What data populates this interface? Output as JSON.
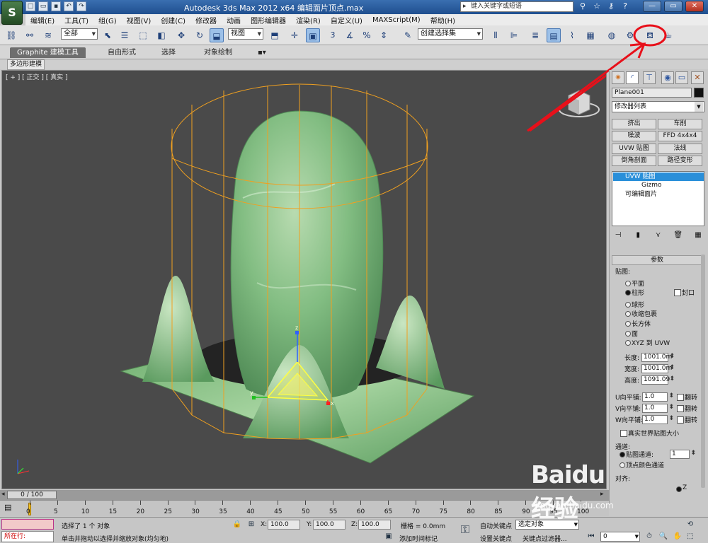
{
  "title": {
    "text": "Autodesk 3ds Max  2012 x64    编辑面片顶点.max",
    "app_logo": "S",
    "search_placeholder": "键入关键字或短语",
    "qa_icons": [
      "new-icon",
      "open-icon",
      "save-icon",
      "undo-icon",
      "redo-icon"
    ],
    "right_icons": [
      "binoculars",
      "star",
      "key",
      "help"
    ]
  },
  "menu": [
    "编辑(E)",
    "工具(T)",
    "组(G)",
    "视图(V)",
    "创建(C)",
    "修改器",
    "动画",
    "图形编辑器",
    "渲染(R)",
    "自定义(U)",
    "MAXScript(M)",
    "帮助(H)"
  ],
  "toolbar": {
    "selection_filter": "全部",
    "ref_coord": "视图",
    "named_selection": "创建选择集",
    "snap_label": "3"
  },
  "ribbon": {
    "tabs": [
      "Graphite 建模工具",
      "自由形式",
      "选择",
      "对象绘制"
    ],
    "sub": "多边形建模"
  },
  "viewport": {
    "label": "[ + ] [ 正交 ] [ 真实 ]",
    "gizmo_axes": {
      "x": "x",
      "y": "y",
      "z": "z"
    }
  },
  "panel": {
    "object_name": "Plane001",
    "modifier_list": "修改器列表",
    "modifier_buttons": [
      "挤出",
      "车削",
      "噪波",
      "FFD 4x4x4",
      "UVW 贴图",
      "法线",
      "倒角剖面",
      "路径变形"
    ],
    "stack": [
      "UVW 贴图",
      "Gizmo",
      "可编辑面片"
    ],
    "rollout_title": "参数",
    "mapping_group": "贴图:",
    "mapping_options": [
      "平面",
      "柱形",
      "球形",
      "收缩包裹",
      "长方体",
      "面",
      "XYZ 到 UVW"
    ],
    "cap_label": "封口",
    "length_label": "长度:",
    "length_value": "1001.0m",
    "width_label": "宽度:",
    "width_value": "1001.0m",
    "height_label": "高度:",
    "height_value": "1091.09",
    "u_tile_label": "U向平铺:",
    "u_tile": "1.0",
    "v_tile_label": "V向平铺:",
    "v_tile": "1.0",
    "w_tile_label": "W向平铺:",
    "w_tile": "1.0",
    "flip_label": "翻转",
    "real_world_label": "真实世界贴图大小",
    "channel_group": "通道:",
    "map_channel_label": "贴图通道:",
    "map_channel_value": "1",
    "vertex_color_label": "顶点颜色通道",
    "align_group": "对齐:",
    "align_z": "Z"
  },
  "timeline": {
    "frame_display": "0 / 100",
    "ticks": [
      "0",
      "5",
      "10",
      "15",
      "20",
      "25",
      "30",
      "35",
      "40",
      "45",
      "50",
      "55",
      "60",
      "65",
      "70",
      "75",
      "80",
      "85",
      "90",
      "95",
      "100"
    ]
  },
  "status": {
    "listener_text": "所在行:",
    "selection": "选择了 1 个 对象",
    "prompt": "单击并拖动以选择并缩放对象(均匀地)",
    "x_label": "X:",
    "x_value": "100.0",
    "y_label": "Y:",
    "y_value": "100.0",
    "z_label": "Z:",
    "z_value": "100.0",
    "grid": "栅格 = 0.0mm",
    "add_time_tag": "添加时间标记",
    "auto_key": "自动关键点",
    "selected_dd": "选定对象",
    "set_key": "设置关键点",
    "key_filters": "关键点过滤器...",
    "frame_value": "0"
  },
  "watermark": {
    "logo": "Baidu经验",
    "url": "jingyan.baidu.com"
  },
  "colors": {
    "annotation_red": "#e8101a",
    "gizmo_orange": "#f0a020",
    "mesh_green": "#7fbf7f",
    "selection_blue": "#2a8fd9"
  }
}
